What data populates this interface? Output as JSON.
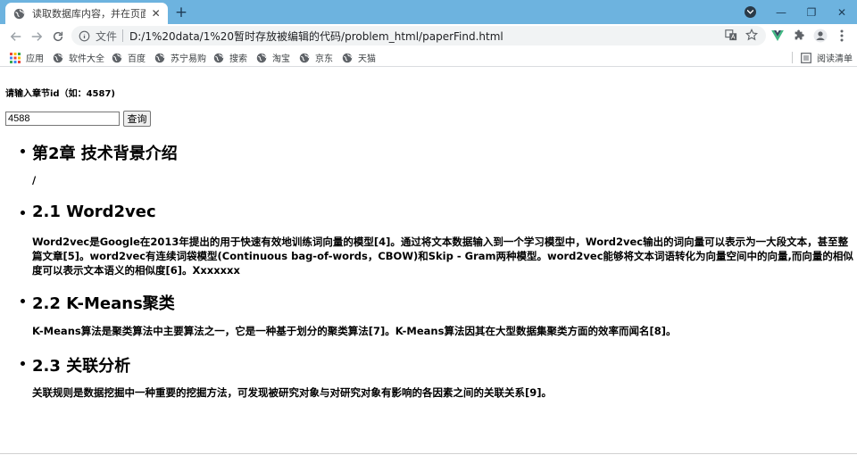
{
  "tab": {
    "title": "读取数据库内容，并在页面渲染",
    "close": "✕",
    "new_tab": "+"
  },
  "window": {
    "minimize": "—",
    "restore": "❐",
    "close": "✕"
  },
  "toolbar": {
    "url_label": "文件",
    "url": "D:/1%20data/1%20暂时存放被编辑的代码/problem_html/paperFind.html"
  },
  "bookmarks": {
    "items": [
      {
        "label": "应用",
        "icon": "apps-grid-icon"
      },
      {
        "label": "软件大全",
        "icon": "globe-icon"
      },
      {
        "label": "百度",
        "icon": "globe-icon"
      },
      {
        "label": "苏宁易购",
        "icon": "globe-icon"
      },
      {
        "label": "搜索",
        "icon": "globe-icon"
      },
      {
        "label": "淘宝",
        "icon": "globe-icon"
      },
      {
        "label": "京东",
        "icon": "globe-icon"
      },
      {
        "label": "天猫",
        "icon": "globe-icon"
      }
    ],
    "reading_list": "阅读清单"
  },
  "page": {
    "prompt": "请输入章节id（如：4587)",
    "input_value": "4588",
    "query_button": "查询",
    "sections": [
      {
        "heading": "第2章 技术背景介绍",
        "body": "/"
      },
      {
        "heading": "2.1 Word2vec",
        "body": "Word2vec是Google在2013年提出的用于快速有效地训练词向量的模型[4]。通过将文本数据输入到一个学习模型中，Word2vec输出的词向量可以表示为一大段文本，甚至整篇文章[5]。word2vec有连续词袋模型(Continuous bag-of-words，CBOW)和Skip - Gram两种模型。word2vec能够将文本词语转化为向量空间中的向量,而向量的相似度可以表示文本语义的相似度[6]。Xxxxxxx"
      },
      {
        "heading": "2.2 K-Means聚类",
        "body": "K-Means算法是聚类算法中主要算法之一，它是一种基于划分的聚类算法[7]。K-Means算法因其在大型数据集聚类方面的效率而闻名[8]。"
      },
      {
        "heading": "2.3 关联分析",
        "body": "关联规则是数据挖掘中一种重要的挖掘方法，可发现被研究对象与对研究对象有影响的各因素之间的关联关系[9]。"
      }
    ]
  },
  "colors": {
    "titlebar": "#6db3df",
    "omnibox": "#f1f3f4",
    "vue_icon": "#41b883"
  }
}
